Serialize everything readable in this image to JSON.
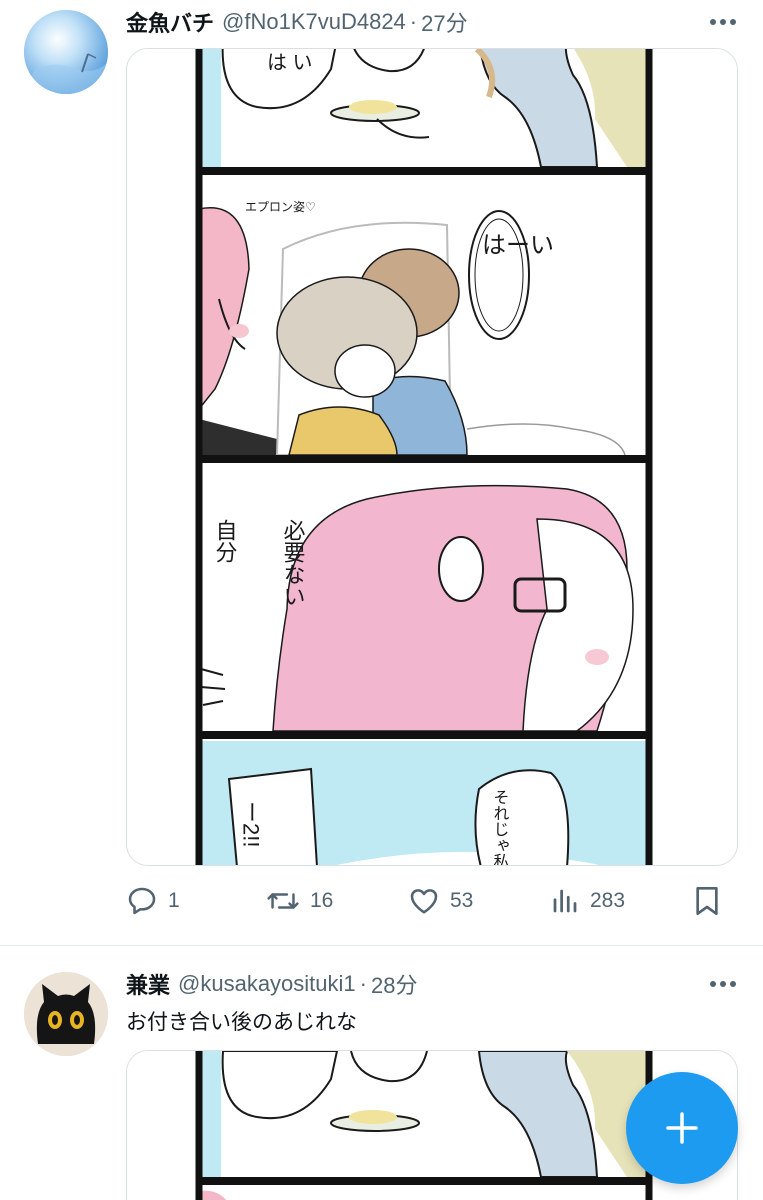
{
  "tweets": [
    {
      "name": "金魚バチ",
      "handle": "@fNo1K7vuD4824",
      "separator": "·",
      "time": "27分",
      "text": "",
      "stats": {
        "replies": "1",
        "retweets": "16",
        "likes": "53",
        "views": "283"
      },
      "media": {
        "panel1_bubble_text": "は\nい",
        "panel2_bubble_text": "はーい",
        "panel2_side_text": "エプロン姿♡",
        "panel3_vertical_text": "必要ない",
        "panel3_side_text": "自分",
        "panel4_left_text": "ー2!!",
        "panel4_right_text": "それじゃ私帰る"
      }
    },
    {
      "name": "兼業",
      "handle": "@kusakayosituki1",
      "separator": "·",
      "time": "28分",
      "text": "お付き合い後のあじれな"
    }
  ],
  "icons": {
    "more": "more-horizontal-icon",
    "reply": "reply-bubble-icon",
    "retweet": "retweet-icon",
    "like": "heart-icon",
    "views": "views-bar-chart-icon",
    "bookmark": "bookmark-icon",
    "compose": "plus-icon"
  },
  "colors": {
    "accent": "#1d9bf0",
    "text_secondary": "#536471",
    "divider": "#e6ecf0"
  }
}
